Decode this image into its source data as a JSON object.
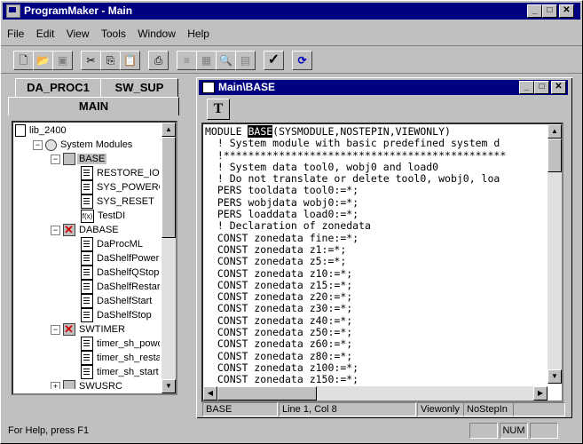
{
  "window": {
    "title": "ProgramMaker - Main"
  },
  "menu": [
    "File",
    "Edit",
    "View",
    "Tools",
    "Window",
    "Help"
  ],
  "left_panel": {
    "tabs": [
      "DA_PROC1",
      "SW_SUP"
    ],
    "active_tab": "MAIN",
    "tree": [
      {
        "label": "lib_2400",
        "depth": 0,
        "icon": "library-icon",
        "expander": ""
      },
      {
        "label": "System Modules",
        "depth": 1,
        "icon": "gear-icon",
        "expander": "−"
      },
      {
        "label": "BASE",
        "depth": 2,
        "icon": "module-icon",
        "expander": "−",
        "selected": true
      },
      {
        "label": "RESTORE_IO",
        "depth": 3,
        "icon": "procedure-icon",
        "expander": ""
      },
      {
        "label": "SYS_POWEROI",
        "depth": 3,
        "icon": "procedure-icon",
        "expander": ""
      },
      {
        "label": "SYS_RESET",
        "depth": 3,
        "icon": "procedure-icon",
        "expander": ""
      },
      {
        "label": "TestDI",
        "depth": 3,
        "icon": "function-icon",
        "expander": ""
      },
      {
        "label": "DABASE",
        "depth": 2,
        "icon": "module-error-icon",
        "expander": "−"
      },
      {
        "label": "DaProcML",
        "depth": 3,
        "icon": "procedure-icon",
        "expander": ""
      },
      {
        "label": "DaShelfPowerO",
        "depth": 3,
        "icon": "procedure-icon",
        "expander": ""
      },
      {
        "label": "DaShelfQStop",
        "depth": 3,
        "icon": "procedure-icon",
        "expander": ""
      },
      {
        "label": "DaShelfRestart",
        "depth": 3,
        "icon": "procedure-icon",
        "expander": ""
      },
      {
        "label": "DaShelfStart",
        "depth": 3,
        "icon": "procedure-icon",
        "expander": ""
      },
      {
        "label": "DaShelfStop",
        "depth": 3,
        "icon": "procedure-icon",
        "expander": ""
      },
      {
        "label": "SWTIMER",
        "depth": 2,
        "icon": "module-error-icon",
        "expander": "−"
      },
      {
        "label": "timer_sh_powon",
        "depth": 3,
        "icon": "procedure-icon",
        "expander": ""
      },
      {
        "label": "timer_sh_restart",
        "depth": 3,
        "icon": "procedure-icon",
        "expander": ""
      },
      {
        "label": "timer_sh_start",
        "depth": 3,
        "icon": "procedure-icon",
        "expander": ""
      },
      {
        "label": "SWUSRC",
        "depth": 2,
        "icon": "module-icon",
        "expander": "+"
      }
    ]
  },
  "editor": {
    "title": "Main\\BASE",
    "toolbar_button": "T",
    "lines": [
      {
        "pre": "MODULE ",
        "kw": "BASE",
        "post": "(SYSMODULE,NOSTEPIN,VIEWONLY)"
      },
      {
        "pre": "  ! System module with basic predefined system d"
      },
      {
        "pre": "  !**********************************************"
      },
      {
        "pre": "  ! System data tool0, wobj0 and load0"
      },
      {
        "pre": "  ! Do not translate or delete tool0, wobj0, loa"
      },
      {
        "pre": "  PERS tooldata tool0:=*;"
      },
      {
        "pre": "  PERS wobjdata wobj0:=*;"
      },
      {
        "pre": "  PERS loaddata load0:=*;"
      },
      {
        "pre": "  ! Declaration of zonedata"
      },
      {
        "pre": "  CONST zonedata fine:=*;"
      },
      {
        "pre": "  CONST zonedata z1:=*;"
      },
      {
        "pre": "  CONST zonedata z5:=*;"
      },
      {
        "pre": "  CONST zonedata z10:=*;"
      },
      {
        "pre": "  CONST zonedata z15:=*;"
      },
      {
        "pre": "  CONST zonedata z20:=*;"
      },
      {
        "pre": "  CONST zonedata z30:=*;"
      },
      {
        "pre": "  CONST zonedata z40:=*;"
      },
      {
        "pre": "  CONST zonedata z50:=*;"
      },
      {
        "pre": "  CONST zonedata z60:=*;"
      },
      {
        "pre": "  CONST zonedata z80:=*;"
      },
      {
        "pre": "  CONST zonedata z100:=*;"
      },
      {
        "pre": "  CONST zonedata z150:=*;"
      }
    ],
    "status": {
      "module": "BASE",
      "position": "Line  1, Col   8",
      "flag1": "Viewonly",
      "flag2": "NoStepIn"
    }
  },
  "statusbar": {
    "help": "For Help, press F1",
    "num": "NUM"
  }
}
